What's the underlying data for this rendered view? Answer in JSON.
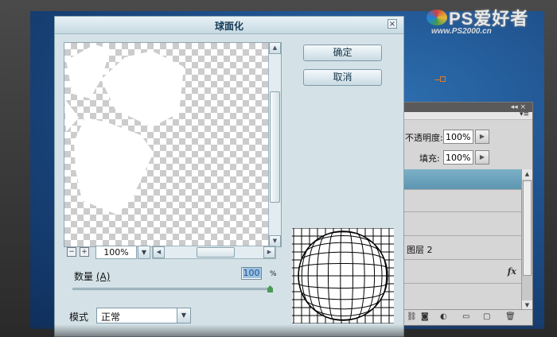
{
  "watermark": {
    "logo": "PS爱好者",
    "url": "www.PS2000.cn"
  },
  "dialog": {
    "title": "球面化",
    "close_glyph": "×",
    "ok_label": "确定",
    "cancel_label": "取消",
    "zoom": {
      "minus": "−",
      "plus": "+",
      "value": "100%"
    },
    "amount": {
      "label": "数量",
      "shortcut": "(A)",
      "value": "100",
      "unit": "%",
      "slider_fraction": 1.0
    },
    "mode": {
      "label": "模式",
      "value": "正常"
    }
  },
  "layers_panel": {
    "opacity_label": "不透明度:",
    "opacity_value": "100%",
    "fill_label": "填充:",
    "fill_value": "100%",
    "layer_name": "图层 2",
    "fx_label": "fx"
  },
  "colors": {
    "dialog_bg": "#d4e2e8",
    "selected_layer": "#5c95b0",
    "canvas_blue": "#1d4f8a"
  }
}
